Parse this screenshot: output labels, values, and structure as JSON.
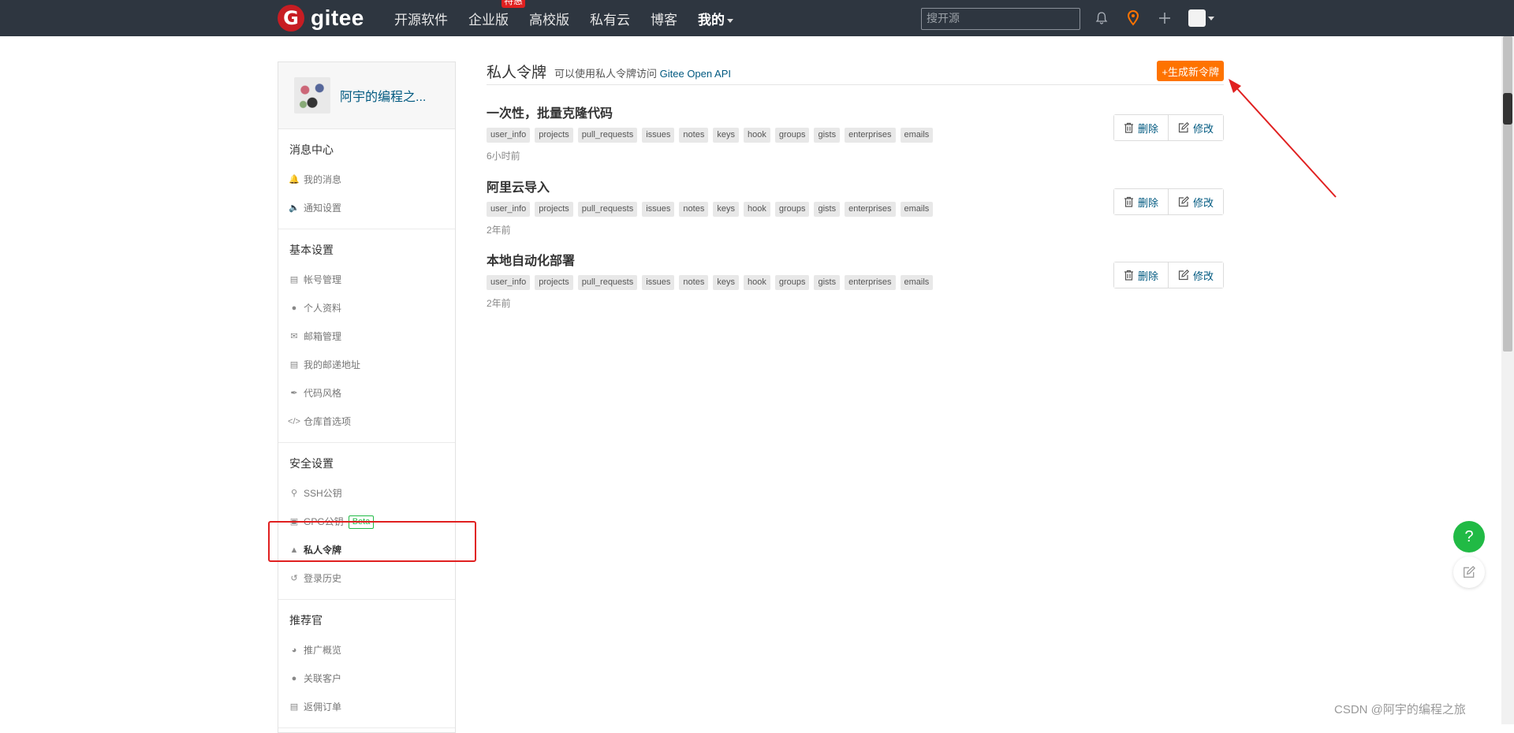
{
  "nav": {
    "logo_letter": "G",
    "logo_text": "gitee",
    "items": [
      {
        "label": "开源软件"
      },
      {
        "label": "企业版",
        "badge": "特惠"
      },
      {
        "label": "高校版"
      },
      {
        "label": "私有云"
      },
      {
        "label": "博客"
      },
      {
        "label": "我的"
      }
    ],
    "search_placeholder": "搜开源",
    "icons": [
      "bell-icon",
      "location-pin-icon",
      "plus-icon",
      "user-avatar"
    ]
  },
  "sidebar": {
    "user_name": "阿宇的编程之...",
    "sections": [
      {
        "title": "消息中心",
        "items": [
          {
            "label": "我的消息",
            "icon": "bell-icon"
          },
          {
            "label": "通知设置",
            "icon": "speaker-icon"
          }
        ]
      },
      {
        "title": "基本设置",
        "items": [
          {
            "label": "帐号管理",
            "icon": "id-card-icon"
          },
          {
            "label": "个人资料",
            "icon": "user-icon"
          },
          {
            "label": "邮箱管理",
            "icon": "mail-icon"
          },
          {
            "label": "我的邮递地址",
            "icon": "address-card-icon"
          },
          {
            "label": "代码风格",
            "icon": "brush-icon"
          },
          {
            "label": "仓库首选项",
            "icon": "code-icon"
          }
        ]
      },
      {
        "title": "安全设置",
        "items": [
          {
            "label": "SSH公钥",
            "icon": "key-icon"
          },
          {
            "label": "GPG公钥",
            "icon": "lock-icon",
            "badge": "Beta"
          },
          {
            "label": "私人令牌",
            "icon": "user-secret-icon",
            "active": true
          },
          {
            "label": "登录历史",
            "icon": "history-icon"
          }
        ]
      },
      {
        "title": "推荐官",
        "items": [
          {
            "label": "推广概览",
            "icon": "dashboard-icon"
          },
          {
            "label": "关联客户",
            "icon": "user-link-icon"
          },
          {
            "label": "返佣订单",
            "icon": "order-icon"
          }
        ]
      }
    ]
  },
  "main": {
    "title": "私人令牌",
    "subtitle_prefix": "可以使用私人令牌访问",
    "subtitle_link": "Gitee Open API",
    "generate_button": "+生成新令牌",
    "delete_label": "删除",
    "edit_label": "修改",
    "tokens": [
      {
        "name": "一次性，批量克隆代码",
        "time": "6小时前",
        "scopes": [
          "user_info",
          "projects",
          "pull_requests",
          "issues",
          "notes",
          "keys",
          "hook",
          "groups",
          "gists",
          "enterprises",
          "emails"
        ]
      },
      {
        "name": "阿里云导入",
        "time": "2年前",
        "scopes": [
          "user_info",
          "projects",
          "pull_requests",
          "issues",
          "notes",
          "keys",
          "hook",
          "groups",
          "gists",
          "enterprises",
          "emails"
        ]
      },
      {
        "name": "本地自动化部署",
        "time": "2年前",
        "scopes": [
          "user_info",
          "projects",
          "pull_requests",
          "issues",
          "notes",
          "keys",
          "hook",
          "groups",
          "gists",
          "enterprises",
          "emails"
        ]
      }
    ]
  },
  "float": {
    "help": "?"
  },
  "watermark": "CSDN @阿宇的编程之旅",
  "colors": {
    "topbar": "#2e3640",
    "brand": "#c71d23",
    "accent": "#fe7300",
    "link": "#005980",
    "annotation": "#e02020",
    "help": "#21ba45"
  }
}
